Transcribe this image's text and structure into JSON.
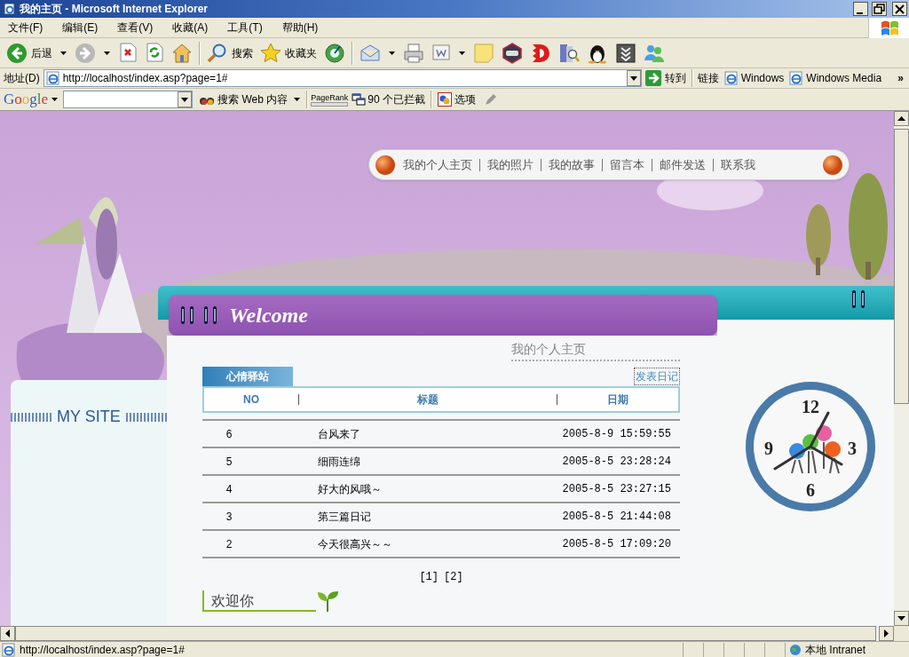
{
  "window": {
    "title": "我的主页 - Microsoft Internet Explorer"
  },
  "menu": [
    "文件(F)",
    "编辑(E)",
    "查看(V)",
    "收藏(A)",
    "工具(T)",
    "帮助(H)"
  ],
  "toolbar": [
    {
      "kind": "back",
      "label": "后退"
    },
    {
      "kind": "forward"
    },
    {
      "kind": "stop"
    },
    {
      "kind": "refresh"
    },
    {
      "kind": "home"
    },
    {
      "kind": "search",
      "label": "搜索"
    },
    {
      "kind": "favorites",
      "label": "收藏夹"
    },
    {
      "kind": "media"
    },
    {
      "kind": "mail"
    },
    {
      "kind": "print"
    },
    {
      "kind": "edit"
    },
    {
      "kind": "note"
    },
    {
      "kind": "game"
    },
    {
      "kind": "red"
    },
    {
      "kind": "research"
    },
    {
      "kind": "penguin"
    },
    {
      "kind": "download"
    },
    {
      "kind": "messenger"
    }
  ],
  "address": {
    "label": "地址(D)",
    "url": "http://localhost/index.asp?page=1#",
    "go": "转到",
    "links_label": "链接",
    "links": [
      "Windows",
      "Windows Media"
    ],
    "more": "»"
  },
  "google_bar": {
    "logo": "Google",
    "search_button": "搜索 Web 内容",
    "pagerank": "PageRank",
    "blocked": "90 个已拦截",
    "options": "选项"
  },
  "page": {
    "nav": [
      "我的个人主页",
      "我的照片",
      "我的故事",
      "留言本",
      "邮件发送",
      "联系我"
    ],
    "sidebar_title": "MY SITE",
    "header": "Welcome",
    "subtitle": "我的个人主页",
    "tab": "心情驿站",
    "post_link": "发表日记",
    "columns": [
      "NO",
      "标题",
      "日期"
    ],
    "rows": [
      {
        "no": "6",
        "title": "台风来了",
        "date": "2005-8-9 15:59:55"
      },
      {
        "no": "5",
        "title": "细雨连绵",
        "date": "2005-8-5 23:28:24"
      },
      {
        "no": "4",
        "title": "好大的风哦～",
        "date": "2005-8-5 23:27:15"
      },
      {
        "no": "3",
        "title": "第三篇日记",
        "date": "2005-8-5 21:44:08"
      },
      {
        "no": "2",
        "title": "今天很高兴～～",
        "date": "2005-8-5 17:09:20"
      }
    ],
    "pager": [
      "[1]",
      "[2]"
    ],
    "section": "欢迎你",
    "clock": [
      "12",
      "3",
      "6",
      "9"
    ]
  },
  "status_bar": {
    "url": "http://localhost/index.asp?page=1#",
    "zone": "本地 Intranet"
  }
}
